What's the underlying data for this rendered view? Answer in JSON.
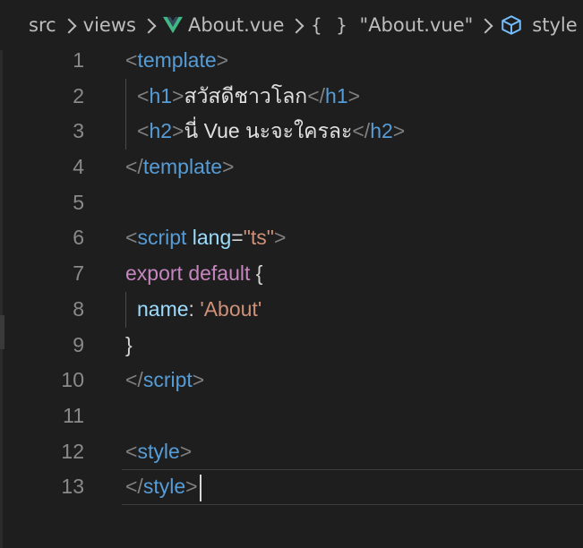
{
  "breadcrumb": {
    "src": "src",
    "views": "views",
    "file": "About.vue",
    "braces": "{ }",
    "symbol": "\"About.vue\"",
    "style": "style"
  },
  "line_numbers": [
    "1",
    "2",
    "3",
    "4",
    "5",
    "6",
    "7",
    "8",
    "9",
    "10",
    "11",
    "12",
    "13"
  ],
  "code": {
    "l1": {
      "open": "<",
      "tag": "template",
      "close": ">"
    },
    "l2": {
      "open": "<",
      "tag": "h1",
      "close": ">",
      "text": "สวัสดีชาวโลก",
      "end_open": "</",
      "end_tag": "h1",
      "end_close": ">"
    },
    "l3": {
      "open": "<",
      "tag": "h2",
      "close": ">",
      "text": "นี่ Vue นะจะใครละ",
      "end_open": "</",
      "end_tag": "h2",
      "end_close": ">"
    },
    "l4": {
      "open": "</",
      "tag": "template",
      "close": ">"
    },
    "l6": {
      "open": "<",
      "tag": "script",
      "space": " ",
      "attr": "lang",
      "eq": "=",
      "value": "\"ts\"",
      "close": ">"
    },
    "l7": {
      "export": "export",
      "default": "default",
      "brace": "{"
    },
    "l8": {
      "key": "name",
      "colon": ": ",
      "value": "'About'"
    },
    "l9": {
      "brace": "}"
    },
    "l10": {
      "open": "</",
      "tag": "script",
      "close": ">"
    },
    "l12": {
      "open": "<",
      "tag": "style",
      "close": ">"
    },
    "l13": {
      "open": "</",
      "tag": "style",
      "close": ">"
    }
  },
  "colors": {
    "background": "#1e1e1e",
    "tag": "#569cd6",
    "punctuation": "#808080",
    "attribute": "#9cdcfe",
    "string": "#ce9178",
    "keyword": "#c586c0",
    "vue_green": "#41b883",
    "symbol_blue": "#75beff"
  },
  "icons": {
    "vue": "vue-logo-icon",
    "braces": "braces-icon",
    "cube": "cube-icon",
    "chevron": "chevron-right-icon"
  }
}
